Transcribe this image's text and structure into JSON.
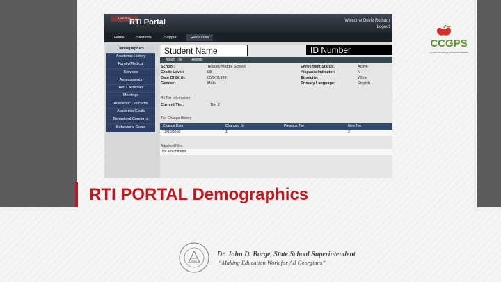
{
  "portal": {
    "logo_text": "GADOE",
    "title": "RTI Portal",
    "welcome": "Welcome Dovie Rotham",
    "logout": "Logout"
  },
  "nav": [
    "Home",
    "Students",
    "Support",
    "Resources"
  ],
  "sidebar": [
    "Demographics",
    "Academic History",
    "Family/Medical",
    "Services",
    "Assessments",
    "Tier 1 Activities",
    "Meetings",
    "Academic Concerns",
    "Academic Goals",
    "Behavioral Concerns",
    "Behavioral Goals"
  ],
  "overlay": {
    "student_name": "Student Name",
    "id_number": "ID Number"
  },
  "subtabs": [
    "Attach File",
    "Reports"
  ],
  "demographics": {
    "school_label": "School:",
    "school": "Teasley Middle School",
    "grade_label": "Grade Level:",
    "grade": "08",
    "dob_label": "Date Of Birth:",
    "dob": "05/07/1999",
    "gender_label": "Gender:",
    "gender": "Male",
    "enroll_label": "Enrollment Status:",
    "enroll": "Active",
    "hisp_label": "Hispanic Indicator:",
    "hisp": "N",
    "eth_label": "Ethnicity:",
    "eth": "White",
    "lang_label": "Primary Language:",
    "lang": "English"
  },
  "tier": {
    "info_link": "Rti Tier Information",
    "current_label": "Current Tier:",
    "current_value": "Tier 2",
    "history_title": "Tier Change History",
    "headers": [
      "Change Date",
      "Changed By",
      "Previous Tier",
      "New Tier"
    ],
    "row": [
      "10/10/2016",
      "1",
      "",
      "2"
    ]
  },
  "attached": {
    "title": "Attached Files",
    "value": "No Attachments"
  },
  "caption": "RTI PORTAL Demographics",
  "ccgps": {
    "letters": "CCGPS",
    "tagline": "Common Core Georgia Performance Standards"
  },
  "footer": {
    "seal_text": "DEPARTMENT OF EDUCATION",
    "supt_name": "Dr. John D. Barge, State School Superintendent",
    "supt_motto": "“Making Education Work for All Georgians”"
  },
  "colors": {
    "accent_red": "#c0181e",
    "nav_navy": "#2d3e63",
    "ccgps_green": "#7cb342"
  }
}
